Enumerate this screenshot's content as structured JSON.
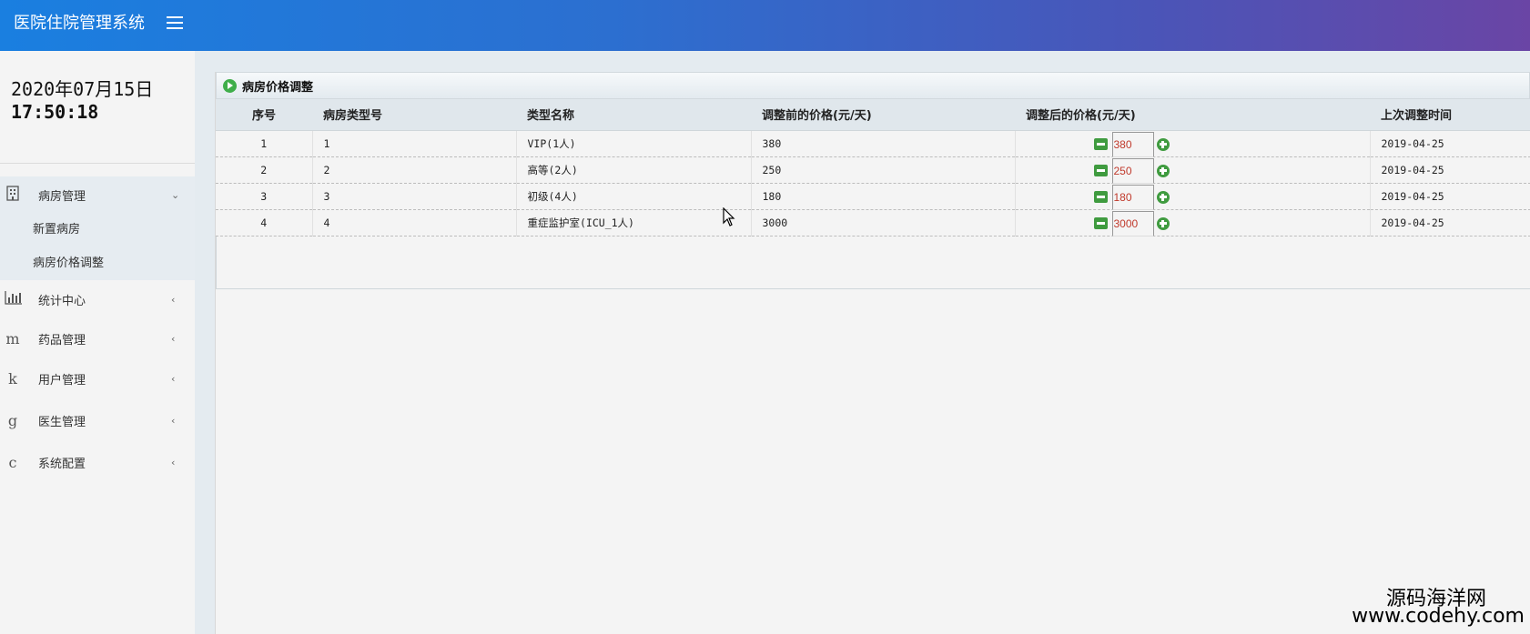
{
  "header": {
    "title": "医院住院管理系统",
    "menu_icon": "hamburger-icon"
  },
  "sidebar": {
    "date": "2020年07月15日",
    "time": "17:50:18",
    "items": [
      {
        "label": "病房管理",
        "icon": "building-icon",
        "icon_glyph": "▯",
        "chevron": "⌄",
        "expanded": true,
        "children": [
          {
            "label": "新置病房"
          },
          {
            "label": "病房价格调整"
          }
        ]
      },
      {
        "label": "统计中心",
        "icon": "bar-chart-icon",
        "icon_glyph": "ıl",
        "chevron": "‹"
      },
      {
        "label": "药品管理",
        "icon": "m-icon",
        "icon_glyph": "m",
        "chevron": "‹"
      },
      {
        "label": "用户管理",
        "icon": "k-icon",
        "icon_glyph": "k",
        "chevron": "‹"
      },
      {
        "label": "医生管理",
        "icon": "g-icon",
        "icon_glyph": "g",
        "chevron": "‹"
      },
      {
        "label": "系统配置",
        "icon": "c-icon",
        "icon_glyph": "c",
        "chevron": "‹"
      }
    ]
  },
  "panel": {
    "title": "病房价格调整",
    "columns": [
      "序号",
      "病房类型号",
      "类型名称",
      "调整前的价格(元/天)",
      "调整后的价格(元/天)",
      "上次调整时间"
    ],
    "rows": [
      {
        "no": "1",
        "type_no": "1",
        "name": "VIP(1人)",
        "before": "380",
        "after": "380",
        "last": "2019-04-25"
      },
      {
        "no": "2",
        "type_no": "2",
        "name": "高等(2人)",
        "before": "250",
        "after": "250",
        "last": "2019-04-25"
      },
      {
        "no": "3",
        "type_no": "3",
        "name": "初级(4人)",
        "before": "180",
        "after": "180",
        "last": "2019-04-25"
      },
      {
        "no": "4",
        "type_no": "4",
        "name": "重症监护室(ICU_1人)",
        "before": "3000",
        "after": "3000",
        "last": "2019-04-25"
      }
    ]
  },
  "watermark": {
    "cn": "源码海洋网",
    "en": "www.codehy.com"
  },
  "colors": {
    "header_start": "#1a7fe0",
    "header_end": "#6a45a5",
    "accent_green": "#3f9b3f",
    "price_red": "#c0392b"
  }
}
